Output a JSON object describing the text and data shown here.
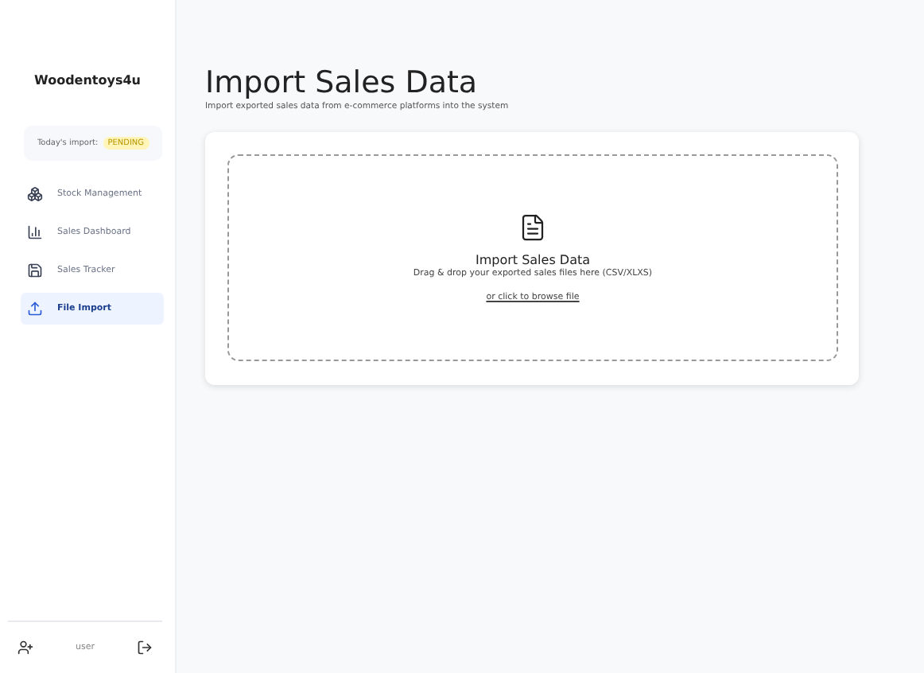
{
  "sidebar": {
    "brand": "Woodentoys4u",
    "import_status": {
      "label": "Today's import:",
      "badge": "PENDING"
    },
    "items": [
      {
        "label": "Stock Management",
        "selected": false
      },
      {
        "label": "Sales Dashboard",
        "selected": false
      },
      {
        "label": "Sales Tracker",
        "selected": false
      },
      {
        "label": "File Import",
        "selected": true
      }
    ],
    "user": {
      "name": "user"
    }
  },
  "main": {
    "title": "Import Sales Data",
    "subtitle": "Import exported sales data from e-commerce platforms into the system",
    "dropzone": {
      "title": "Import Sales Data",
      "hint": "Drag & drop your exported sales files here (CSV/XLXS)",
      "link": "or click to browse file"
    }
  }
}
